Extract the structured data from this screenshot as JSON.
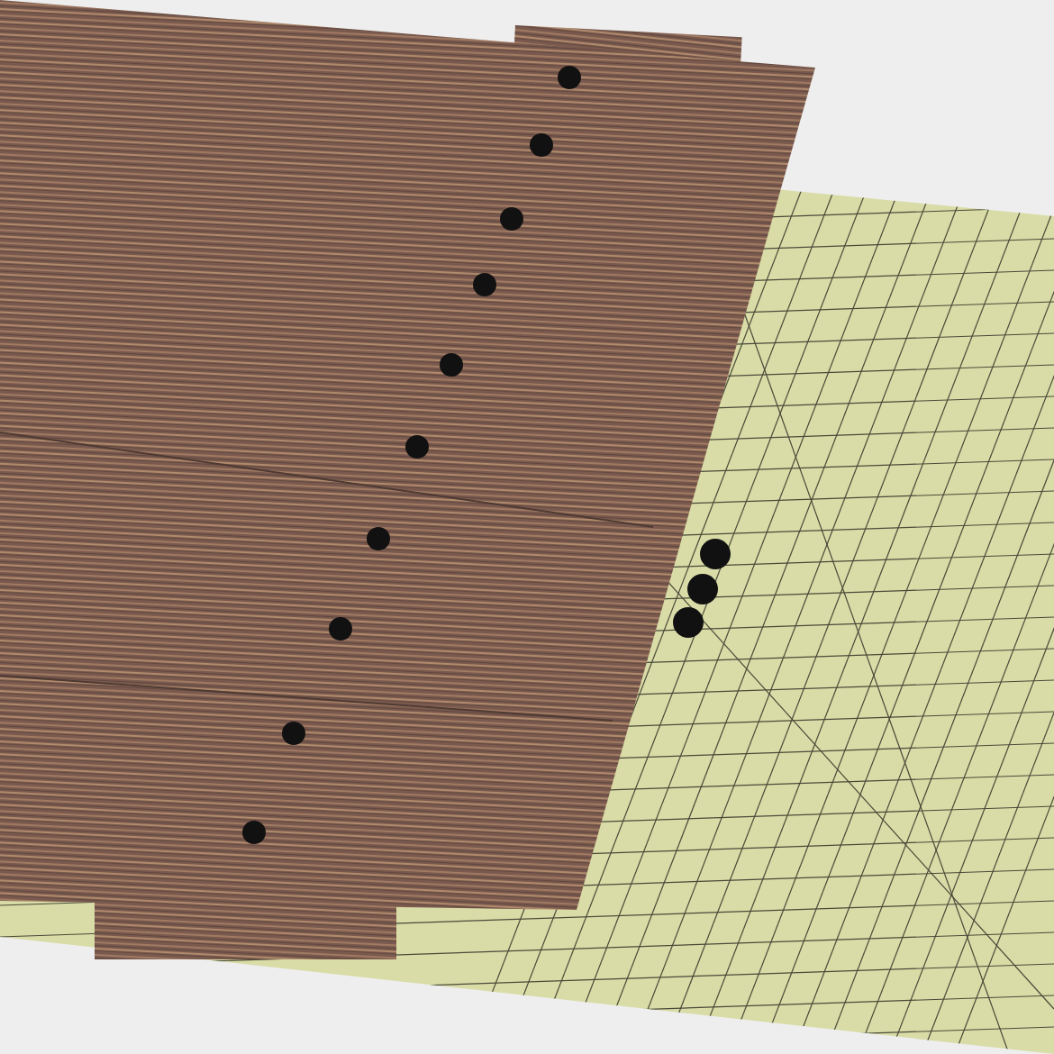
{
  "photo": {
    "kind": "drawing"
  }
}
